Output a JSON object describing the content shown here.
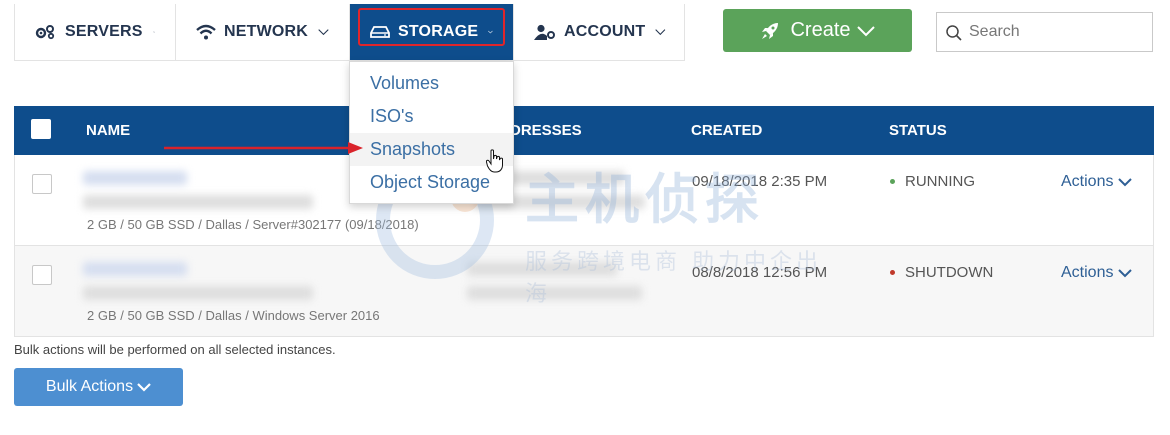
{
  "nav": {
    "servers": "SERVERS",
    "network": "NETWORK",
    "storage": "STORAGE",
    "account": "ACCOUNT"
  },
  "create": {
    "label": "Create"
  },
  "search": {
    "placeholder": "Search"
  },
  "storage_menu": {
    "items": [
      "Volumes",
      "ISO's",
      "Snapshots",
      "Object Storage"
    ]
  },
  "table": {
    "headers": {
      "name": "NAME",
      "ip": "IP ADDRESSES",
      "ip_visible": "DRESSES",
      "created": "CREATED",
      "status": "STATUS"
    },
    "rows": [
      {
        "spec": "2 GB / 50 GB SSD / Dallas / Server#302177 (09/18/2018)",
        "created": "09/18/2018 2:35 PM",
        "status": "RUNNING",
        "status_color": "#5ba35a",
        "actions": "Actions"
      },
      {
        "spec": "2 GB / 50 GB SSD / Dallas / Windows Server 2016",
        "created": "08/8/2018 12:56 PM",
        "status": "SHUTDOWN",
        "status_color": "#c0392b",
        "actions": "Actions"
      }
    ]
  },
  "bulk": {
    "note": "Bulk actions will be performed on all selected instances.",
    "button": "Bulk Actions"
  },
  "watermark": {
    "main": "主机侦探",
    "sub": "服务跨境电商 助力中企出海"
  },
  "colors": {
    "nav_active": "#0e4d8c",
    "create": "#5ba35a",
    "bulk": "#4d8fd1",
    "highlight": "#e0252b",
    "link": "#2e5f95"
  }
}
